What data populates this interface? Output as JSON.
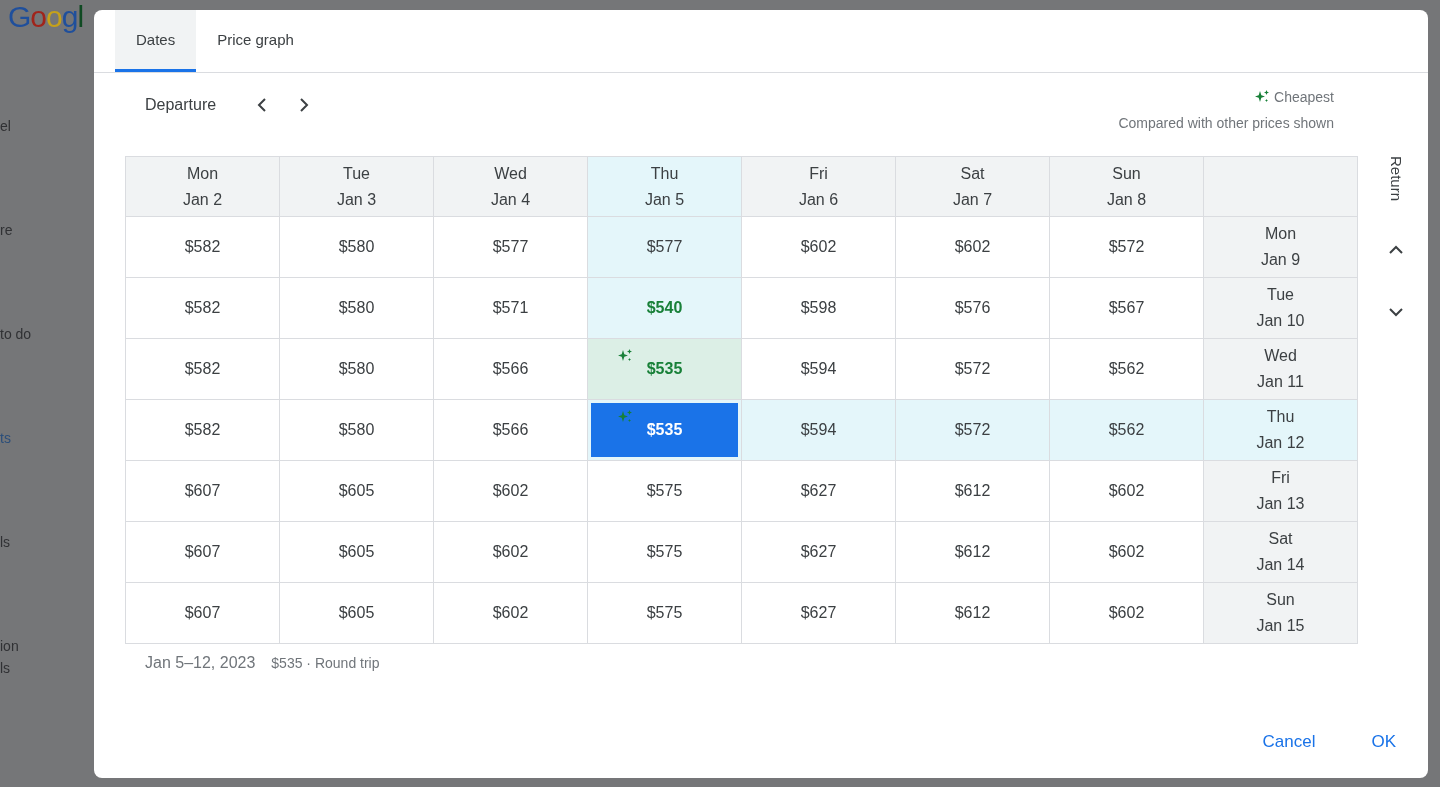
{
  "background": {
    "logo": "Googl",
    "nav_items": [
      {
        "label": "el",
        "selected": false
      },
      {
        "label": "re",
        "selected": false
      },
      {
        "label": "to do",
        "selected": false
      },
      {
        "label": "ts",
        "selected": true
      },
      {
        "label": "ls",
        "selected": false
      },
      {
        "label": "ion\nls",
        "selected": false
      }
    ]
  },
  "dialog": {
    "tabs": [
      {
        "label": "Dates",
        "selected": true
      },
      {
        "label": "Price graph",
        "selected": false
      }
    ],
    "departure_label": "Departure",
    "legend": {
      "label": "Cheapest",
      "note": "Compared with other prices shown"
    },
    "grid": {
      "return_label": "Return",
      "columns": [
        {
          "day": "Mon",
          "date": "Jan 2",
          "selected": false
        },
        {
          "day": "Tue",
          "date": "Jan 3",
          "selected": false
        },
        {
          "day": "Wed",
          "date": "Jan 4",
          "selected": false
        },
        {
          "day": "Thu",
          "date": "Jan 5",
          "selected": true
        },
        {
          "day": "Fri",
          "date": "Jan 6",
          "selected": false
        },
        {
          "day": "Sat",
          "date": "Jan 7",
          "selected": false
        },
        {
          "day": "Sun",
          "date": "Jan 8",
          "selected": false
        }
      ],
      "rows": [
        {
          "day": "Mon",
          "date": "Jan 9",
          "selected": false,
          "cells": [
            {
              "price": "$582",
              "kind": "normal"
            },
            {
              "price": "$580",
              "kind": "normal"
            },
            {
              "price": "$577",
              "kind": "normal"
            },
            {
              "price": "$577",
              "kind": "normal"
            },
            {
              "price": "$602",
              "kind": "normal"
            },
            {
              "price": "$602",
              "kind": "normal"
            },
            {
              "price": "$572",
              "kind": "normal"
            }
          ]
        },
        {
          "day": "Tue",
          "date": "Jan 10",
          "selected": false,
          "cells": [
            {
              "price": "$582",
              "kind": "normal"
            },
            {
              "price": "$580",
              "kind": "normal"
            },
            {
              "price": "$571",
              "kind": "normal"
            },
            {
              "price": "$540",
              "kind": "cheap"
            },
            {
              "price": "$598",
              "kind": "normal"
            },
            {
              "price": "$576",
              "kind": "normal"
            },
            {
              "price": "$567",
              "kind": "normal"
            }
          ]
        },
        {
          "day": "Wed",
          "date": "Jan 11",
          "selected": false,
          "cells": [
            {
              "price": "$582",
              "kind": "normal"
            },
            {
              "price": "$580",
              "kind": "normal"
            },
            {
              "price": "$566",
              "kind": "normal"
            },
            {
              "price": "$535",
              "kind": "cheapest"
            },
            {
              "price": "$594",
              "kind": "normal"
            },
            {
              "price": "$572",
              "kind": "normal"
            },
            {
              "price": "$562",
              "kind": "normal"
            }
          ]
        },
        {
          "day": "Thu",
          "date": "Jan 12",
          "selected": true,
          "cells": [
            {
              "price": "$582",
              "kind": "normal"
            },
            {
              "price": "$580",
              "kind": "normal"
            },
            {
              "price": "$566",
              "kind": "normal"
            },
            {
              "price": "$535",
              "kind": "cheapest"
            },
            {
              "price": "$594",
              "kind": "normal"
            },
            {
              "price": "$572",
              "kind": "normal"
            },
            {
              "price": "$562",
              "kind": "normal"
            }
          ]
        },
        {
          "day": "Fri",
          "date": "Jan 13",
          "selected": false,
          "cells": [
            {
              "price": "$607",
              "kind": "normal"
            },
            {
              "price": "$605",
              "kind": "normal"
            },
            {
              "price": "$602",
              "kind": "normal"
            },
            {
              "price": "$575",
              "kind": "normal"
            },
            {
              "price": "$627",
              "kind": "normal"
            },
            {
              "price": "$612",
              "kind": "normal"
            },
            {
              "price": "$602",
              "kind": "normal"
            }
          ]
        },
        {
          "day": "Sat",
          "date": "Jan 14",
          "selected": false,
          "cells": [
            {
              "price": "$607",
              "kind": "normal"
            },
            {
              "price": "$605",
              "kind": "normal"
            },
            {
              "price": "$602",
              "kind": "normal"
            },
            {
              "price": "$575",
              "kind": "normal"
            },
            {
              "price": "$627",
              "kind": "normal"
            },
            {
              "price": "$612",
              "kind": "normal"
            },
            {
              "price": "$602",
              "kind": "normal"
            }
          ]
        },
        {
          "day": "Sun",
          "date": "Jan 15",
          "selected": false,
          "cells": [
            {
              "price": "$607",
              "kind": "normal"
            },
            {
              "price": "$605",
              "kind": "normal"
            },
            {
              "price": "$602",
              "kind": "normal"
            },
            {
              "price": "$575",
              "kind": "normal"
            },
            {
              "price": "$627",
              "kind": "normal"
            },
            {
              "price": "$612",
              "kind": "normal"
            },
            {
              "price": "$602",
              "kind": "normal"
            }
          ]
        }
      ]
    },
    "summary": {
      "dates": "Jan 5–12, 2023",
      "price": "$535 · Round trip"
    },
    "buttons": [
      {
        "label": "Cancel"
      },
      {
        "label": "OK"
      }
    ]
  }
}
